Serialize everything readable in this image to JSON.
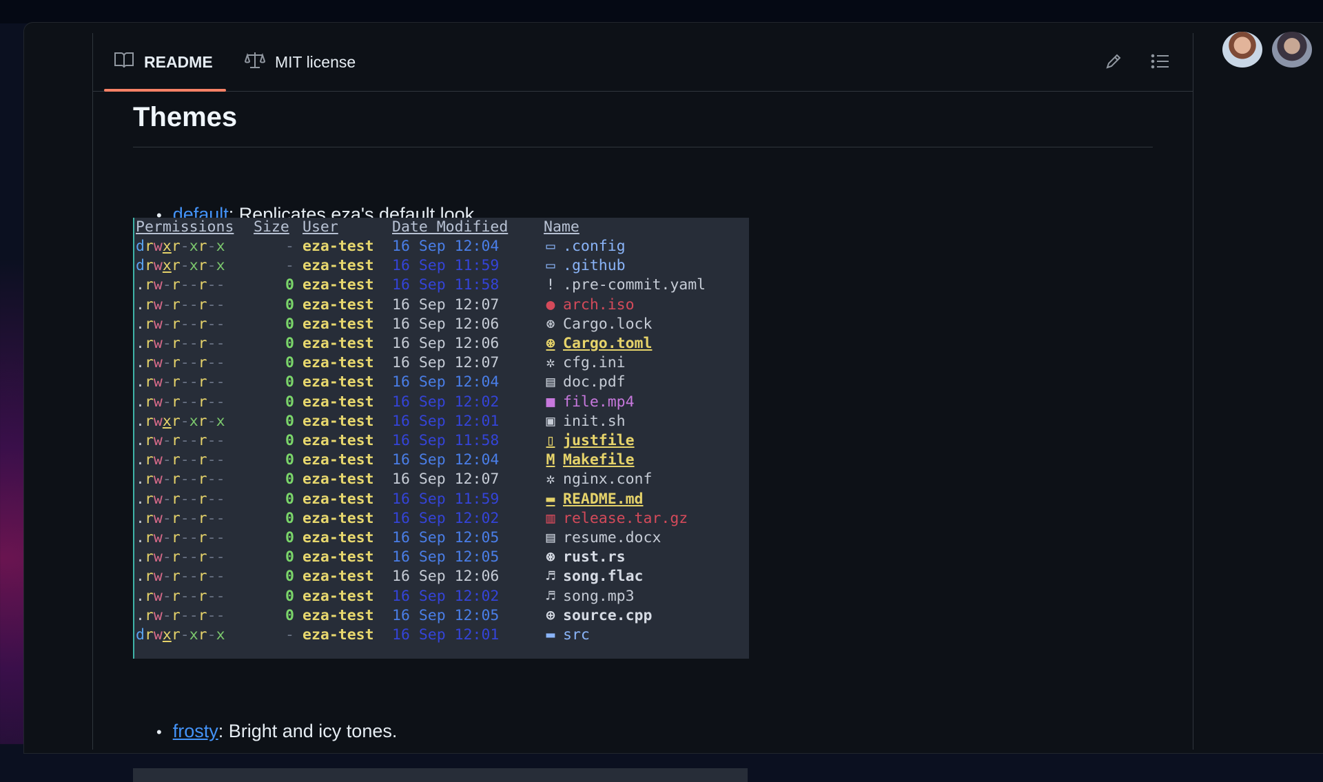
{
  "tabs": {
    "readme_label": "README",
    "license_label": "MIT license"
  },
  "content": {
    "heading": "Themes",
    "bullet1": {
      "link": "default",
      "text": ": Replicates eza's default look."
    },
    "bullet2": {
      "link": "frosty",
      "text": ": Bright and icy tones."
    }
  },
  "terminal": {
    "headers": {
      "permissions": "Permissions",
      "size": "Size",
      "user": "User",
      "date": "Date Modified",
      "name": "Name"
    },
    "rows": [
      {
        "perm": "drwxr-xr-x",
        "size": "-",
        "user": "eza-test",
        "date": "16 Sep 12:04",
        "icon": "▭",
        "name": ".config",
        "date_style": "dt-b",
        "name_style": "n-dir"
      },
      {
        "perm": "drwxr-xr-x",
        "size": "-",
        "user": "eza-test",
        "date": "16 Sep 11:59",
        "icon": "▭",
        "name": ".github",
        "date_style": "dt-db",
        "name_style": "n-dir"
      },
      {
        "perm": ".rw-r--r--",
        "size": "0",
        "user": "eza-test",
        "date": "16 Sep 11:58",
        "icon": "!",
        "name": ".pre-commit.yaml",
        "date_style": "dt-db",
        "name_style": "n-plain"
      },
      {
        "perm": ".rw-r--r--",
        "size": "0",
        "user": "eza-test",
        "date": "16 Sep 12:07",
        "icon": "●",
        "name": "arch.iso",
        "date_style": "dt-w",
        "name_style": "n-red"
      },
      {
        "perm": ".rw-r--r--",
        "size": "0",
        "user": "eza-test",
        "date": "16 Sep 12:06",
        "icon": "⊛",
        "name": "Cargo.lock",
        "date_style": "dt-w",
        "name_style": "n-plain"
      },
      {
        "perm": ".rw-r--r--",
        "size": "0",
        "user": "eza-test",
        "date": "16 Sep 12:06",
        "icon": "⊛",
        "name": "Cargo.toml",
        "date_style": "dt-w",
        "name_style": "n-ul"
      },
      {
        "perm": ".rw-r--r--",
        "size": "0",
        "user": "eza-test",
        "date": "16 Sep 12:07",
        "icon": "✲",
        "name": "cfg.ini",
        "date_style": "dt-w",
        "name_style": "n-plain"
      },
      {
        "perm": ".rw-r--r--",
        "size": "0",
        "user": "eza-test",
        "date": "16 Sep 12:04",
        "icon": "▤",
        "name": "doc.pdf",
        "date_style": "dt-b",
        "name_style": "n-plain"
      },
      {
        "perm": ".rw-r--r--",
        "size": "0",
        "user": "eza-test",
        "date": "16 Sep 12:02",
        "icon": "■",
        "name": "file.mp4",
        "date_style": "dt-db",
        "name_style": "n-vid"
      },
      {
        "perm": ".rwxr-xr-x",
        "size": "0",
        "user": "eza-test",
        "date": "16 Sep 12:01",
        "icon": "▣",
        "name": "init.sh",
        "date_style": "dt-db",
        "name_style": "n-sh"
      },
      {
        "perm": ".rw-r--r--",
        "size": "0",
        "user": "eza-test",
        "date": "16 Sep 11:58",
        "icon": "▯",
        "name": "justfile",
        "date_style": "dt-db",
        "name_style": "n-ul"
      },
      {
        "perm": ".rw-r--r--",
        "size": "0",
        "user": "eza-test",
        "date": "16 Sep 12:04",
        "icon": "M",
        "name": "Makefile",
        "date_style": "dt-b",
        "name_style": "n-ul"
      },
      {
        "perm": ".rw-r--r--",
        "size": "0",
        "user": "eza-test",
        "date": "16 Sep 12:07",
        "icon": "✲",
        "name": "nginx.conf",
        "date_style": "dt-w",
        "name_style": "n-plain"
      },
      {
        "perm": ".rw-r--r--",
        "size": "0",
        "user": "eza-test",
        "date": "16 Sep 11:59",
        "icon": "▬",
        "name": "README.md",
        "date_style": "dt-db",
        "name_style": "n-ul"
      },
      {
        "perm": ".rw-r--r--",
        "size": "0",
        "user": "eza-test",
        "date": "16 Sep 12:02",
        "icon": "▥",
        "name": "release.tar.gz",
        "date_style": "dt-db",
        "name_style": "n-red"
      },
      {
        "perm": ".rw-r--r--",
        "size": "0",
        "user": "eza-test",
        "date": "16 Sep 12:05",
        "icon": "▤",
        "name": "resume.docx",
        "date_style": "dt-b",
        "name_style": "n-plain"
      },
      {
        "perm": ".rw-r--r--",
        "size": "0",
        "user": "eza-test",
        "date": "16 Sep 12:05",
        "icon": "⊛",
        "name": "rust.rs",
        "date_style": "dt-b",
        "name_style": "n-bold"
      },
      {
        "perm": ".rw-r--r--",
        "size": "0",
        "user": "eza-test",
        "date": "16 Sep 12:06",
        "icon": "♬",
        "name": "song.flac",
        "date_style": "dt-w",
        "name_style": "n-bold"
      },
      {
        "perm": ".rw-r--r--",
        "size": "0",
        "user": "eza-test",
        "date": "16 Sep 12:02",
        "icon": "♬",
        "name": "song.mp3",
        "date_style": "dt-db",
        "name_style": "n-snd"
      },
      {
        "perm": ".rw-r--r--",
        "size": "0",
        "user": "eza-test",
        "date": "16 Sep 12:05",
        "icon": "⊕",
        "name": "source.cpp",
        "date_style": "dt-b",
        "name_style": "n-bold"
      },
      {
        "perm": "drwxr-xr-x",
        "size": "-",
        "user": "eza-test",
        "date": "16 Sep 12:01",
        "icon": "▬",
        "name": "src",
        "date_style": "dt-db",
        "name_style": "n-dir"
      }
    ]
  },
  "icons": {
    "readme": "book-icon",
    "license": "scale-icon",
    "edit": "pencil-icon",
    "outline": "list-icon"
  },
  "colors": {
    "background": "#0d1117",
    "link": "#4493f8",
    "tab_underline": "#f78166",
    "terminal_bg": "#272d38",
    "user": "#e8d86e",
    "size_zero": "#7bd66a"
  }
}
